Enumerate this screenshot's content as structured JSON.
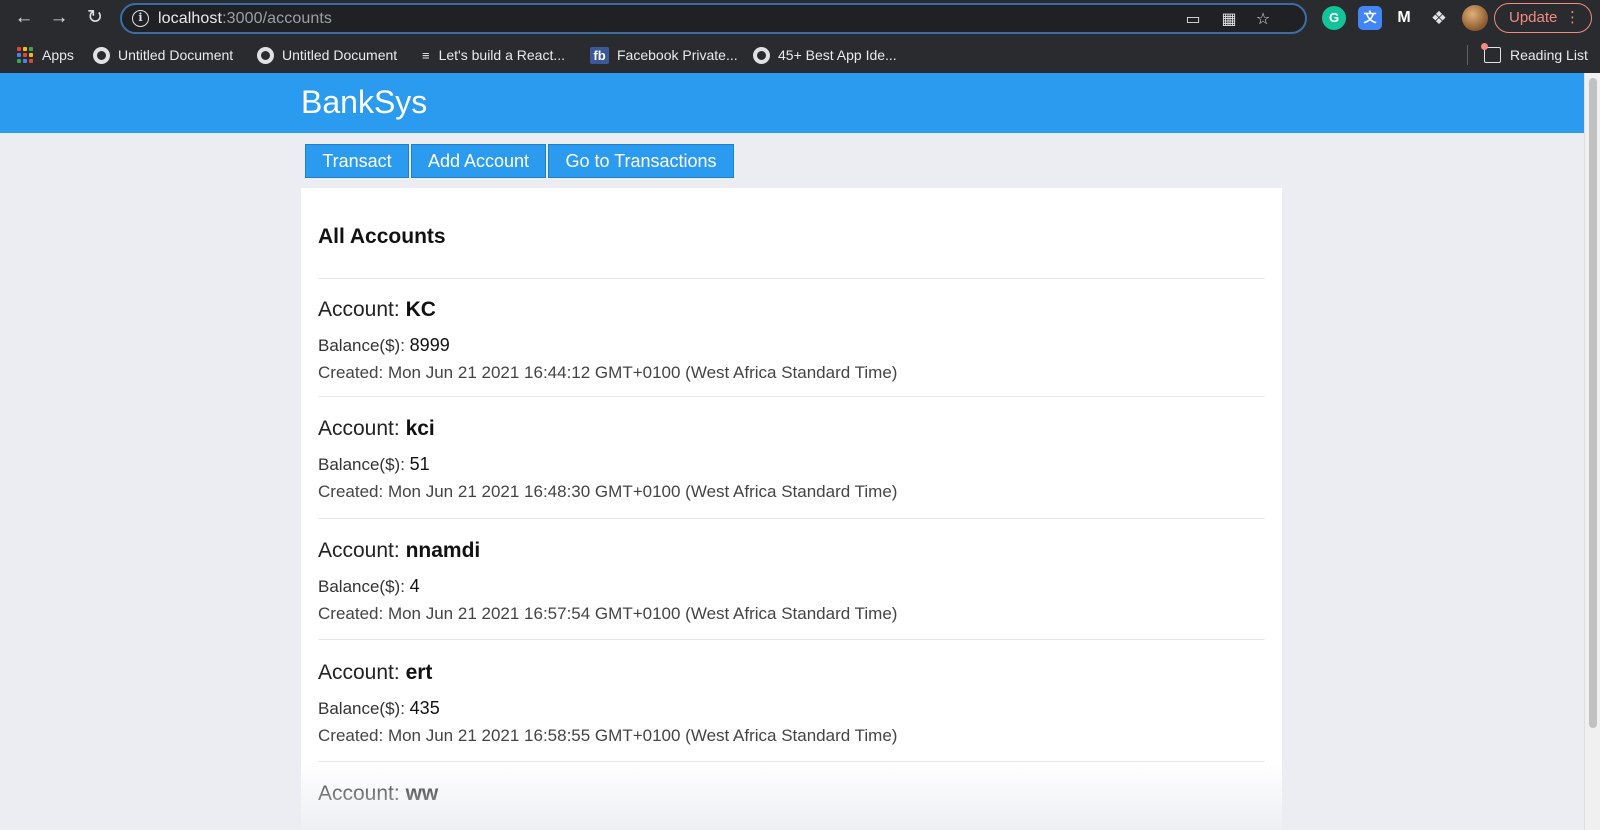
{
  "browser": {
    "url_host": "localhost",
    "url_path": ":3000/accounts",
    "update_label": "Update",
    "bookmarks": [
      {
        "label": "Apps"
      },
      {
        "label": "Untitled Document"
      },
      {
        "label": "Untitled Document"
      },
      {
        "label": "Let's build a React..."
      },
      {
        "label": "Facebook Private..."
      },
      {
        "label": "45+ Best App Ide..."
      }
    ],
    "reading_list_label": "Reading List"
  },
  "app": {
    "brand": "BankSys",
    "nav": {
      "transact_label": "Transact",
      "add_account_label": "Add Account",
      "transactions_label": "Go to Transactions"
    },
    "card_title": "All Accounts",
    "labels": {
      "account": "Account: ",
      "balance": "Balance($): ",
      "created": "Created: "
    },
    "accounts": [
      {
        "name": "KC",
        "balance": "8999",
        "created": "Mon Jun 21 2021 16:44:12 GMT+0100 (West Africa Standard Time)"
      },
      {
        "name": "kci",
        "balance": "51",
        "created": "Mon Jun 21 2021 16:48:30 GMT+0100 (West Africa Standard Time)"
      },
      {
        "name": "nnamdi",
        "balance": "4",
        "created": "Mon Jun 21 2021 16:57:54 GMT+0100 (West Africa Standard Time)"
      },
      {
        "name": "ert",
        "balance": "435",
        "created": "Mon Jun 21 2021 16:58:55 GMT+0100 (West Africa Standard Time)"
      },
      {
        "name": "ww",
        "balance": "",
        "created": ""
      }
    ]
  },
  "colors": {
    "header_blue": "#2b9bf0",
    "page_bg": "#ebedf2",
    "update_red": "#f28b82"
  }
}
